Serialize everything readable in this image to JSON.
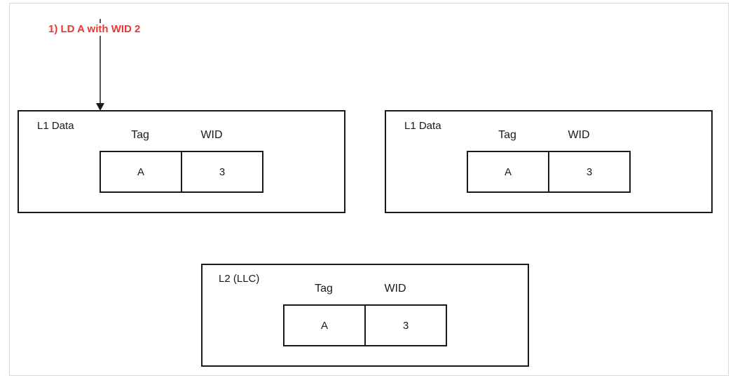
{
  "annotation": {
    "text": "1) LD A with WID 2",
    "color": "#e53935"
  },
  "line_color": "#1a1a1a",
  "caches": [
    {
      "title": "L1 Data",
      "headers": [
        "Tag",
        "WID"
      ],
      "row": [
        "A",
        "3"
      ]
    },
    {
      "title": "L1 Data",
      "headers": [
        "Tag",
        "WID"
      ],
      "row": [
        "A",
        "3"
      ]
    },
    {
      "title": "L2 (LLC)",
      "headers": [
        "Tag",
        "WID"
      ],
      "row": [
        "A",
        "3"
      ]
    }
  ]
}
